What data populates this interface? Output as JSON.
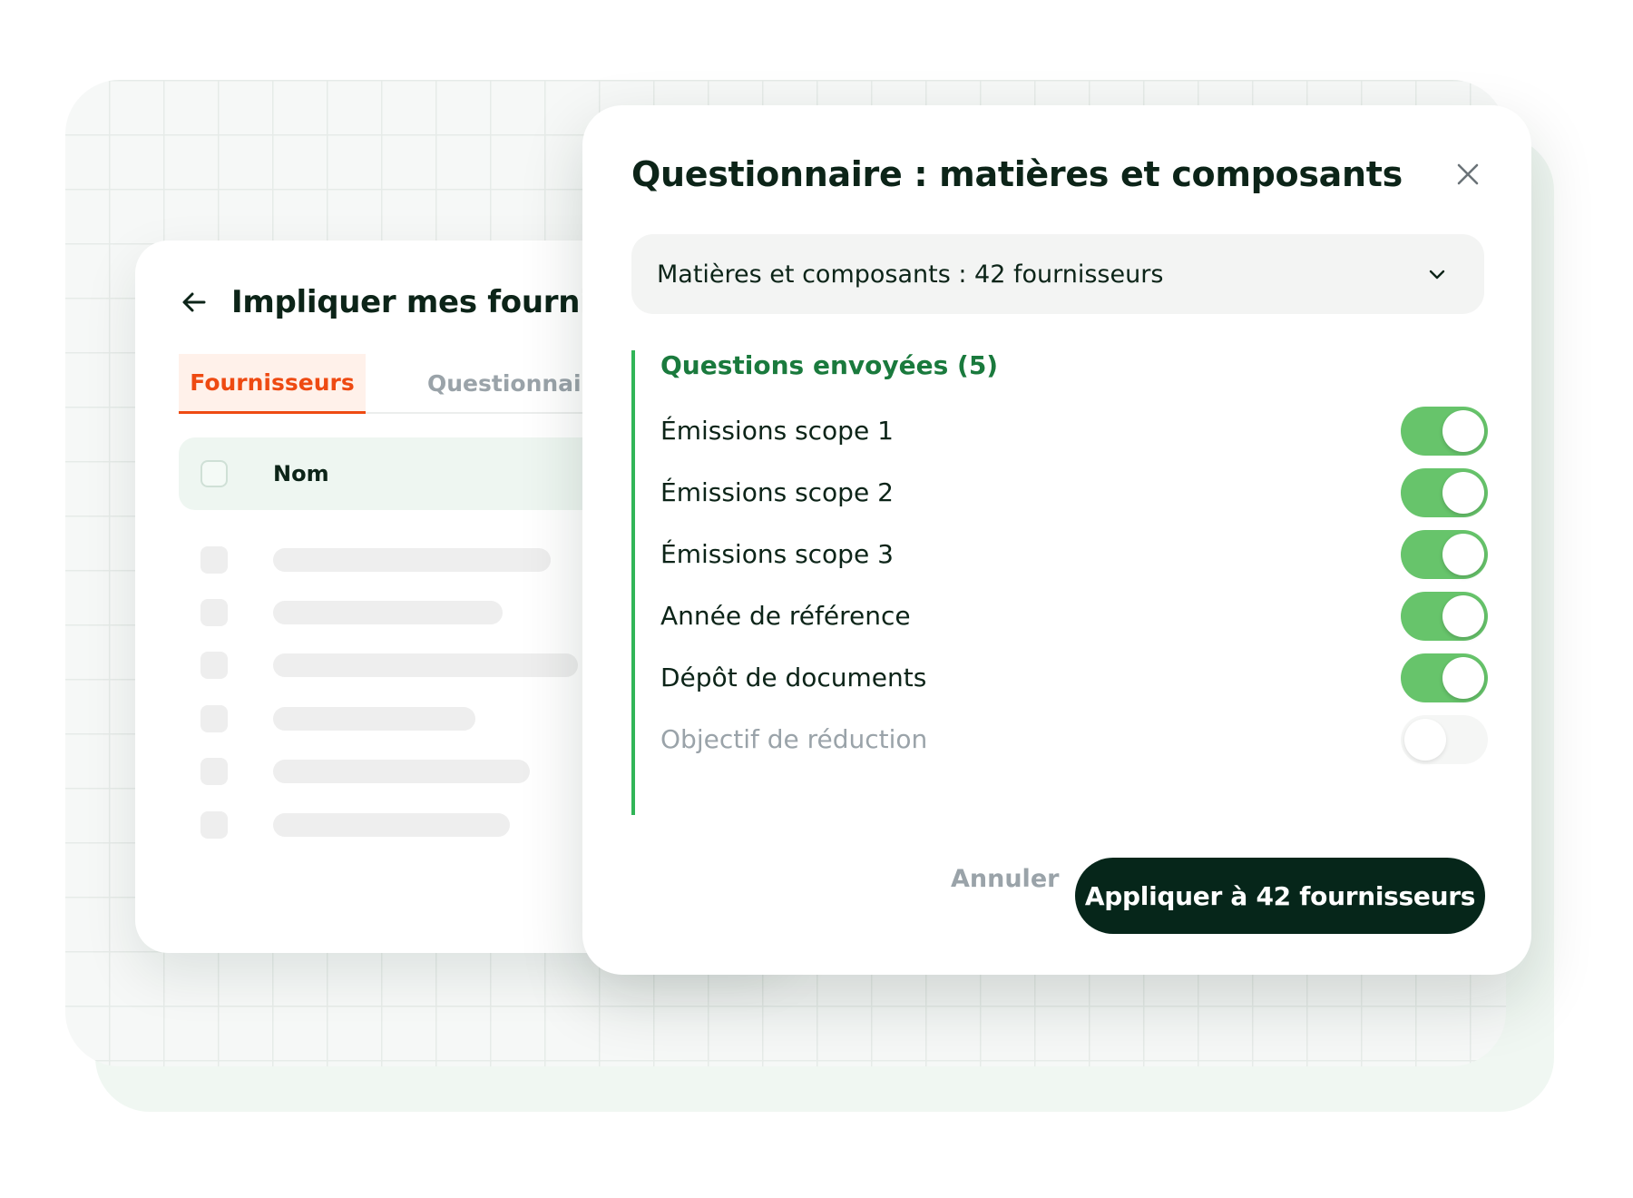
{
  "background_panel": {
    "title": "Impliquer mes fournisse",
    "tabs": [
      {
        "label": "Fournisseurs",
        "active": true
      },
      {
        "label": "Questionnaire",
        "active": false
      }
    ],
    "table": {
      "header": "Nom",
      "placeholder_rows": 6
    }
  },
  "modal": {
    "title": "Questionnaire : matières et composants",
    "select": {
      "value": "Matières et composants : 42 fournisseurs"
    },
    "section_title": "Questions envoyées (5)",
    "questions": [
      {
        "label": "Émissions scope 1",
        "enabled": true
      },
      {
        "label": "Émissions scope 2",
        "enabled": true
      },
      {
        "label": "Émissions scope 3",
        "enabled": true
      },
      {
        "label": "Année de référence",
        "enabled": true
      },
      {
        "label": "Dépôt de documents",
        "enabled": true
      },
      {
        "label": "Objectif de réduction",
        "enabled": false
      }
    ],
    "cancel_label": "Annuler",
    "apply_label": "Appliquer à 42 fournisseurs"
  },
  "colors": {
    "accent_orange": "#ee4a12",
    "toggle_on": "#67c46b",
    "section_green": "#1a7a3d",
    "primary_dark": "#06261a"
  }
}
